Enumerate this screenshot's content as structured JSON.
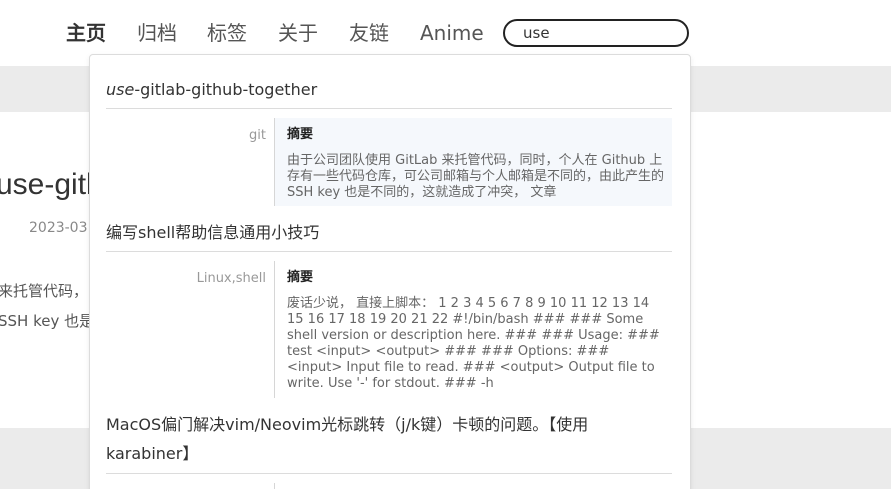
{
  "nav": {
    "items": [
      {
        "label": "主页",
        "active": true
      },
      {
        "label": "归档",
        "active": false
      },
      {
        "label": "标签",
        "active": false
      },
      {
        "label": "关于",
        "active": false
      },
      {
        "label": "友链",
        "active": false
      },
      {
        "label": "Anime",
        "active": false
      }
    ],
    "search_value": "use"
  },
  "background_post": {
    "title": "use-gitl",
    "date": "2023-03",
    "excerpt_line1": "来托管代码，同",
    "excerpt_line2": "SSH key 也是"
  },
  "results": [
    {
      "title_highlight": "use",
      "title_rest": "-gitlab-github-together",
      "tag": "git",
      "abstract_label": "摘要",
      "abstract_text": "由于公司团队使用 GitLab 来托管代码，同时，个人在 Github 上存有一些代码仓库，可公司邮箱与个人邮箱是不同的，由此产生的 SSH key 也是不同的，这就造成了冲突， 文章"
    },
    {
      "title": "编写shell帮助信息通用小技巧",
      "tag": "Linux,shell",
      "abstract_label": "摘要",
      "abstract_text": "废话少说， 直接上脚本： 1 2 3 4 5 6 7 8 9 10 11 12 13 14 15 16 17 18 19 20 21 22 #!/bin/bash ### ### Some shell version or description here. ### ### Usage: ### test <input> <output> ### ### Options: ### <input> Input file to read. ### <output> Output file to write. Use '-' for stdout. ### -h"
    },
    {
      "title": "MacOS偏门解决vim/Neovim光标跳转（j/k键）卡顿的问题。【使用karabiner】"
    }
  ],
  "colors": {
    "background_band": "#ebebeb",
    "highlight_abstract_bg": "#f5f8fc",
    "divider": "#dcdcdc"
  }
}
